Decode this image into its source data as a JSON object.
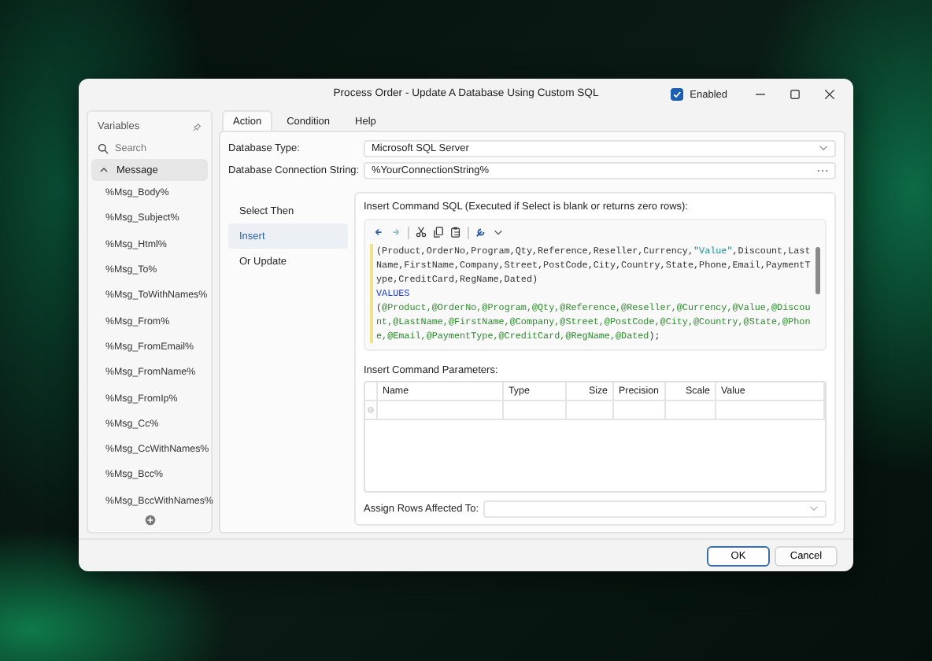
{
  "window": {
    "title": "Process Order - Update A Database Using Custom SQL",
    "enabled": {
      "label": "Enabled",
      "checked": true
    }
  },
  "sidebar": {
    "title": "Variables",
    "search": {
      "placeholder": "Search"
    },
    "group": {
      "label": "Message",
      "expanded": true,
      "selected": true
    },
    "items": [
      "%Msg_Body%",
      "%Msg_Subject%",
      "%Msg_Html%",
      "%Msg_To%",
      "%Msg_ToWithNames%",
      "%Msg_From%",
      "%Msg_FromEmail%",
      "%Msg_FromName%",
      "%Msg_FromIp%",
      "%Msg_Cc%",
      "%Msg_CcWithNames%",
      "%Msg_Bcc%",
      "%Msg_BccWithNames%"
    ]
  },
  "tabs": [
    {
      "label": "Action",
      "selected": true
    },
    {
      "label": "Condition",
      "selected": false
    },
    {
      "label": "Help",
      "selected": false
    }
  ],
  "fields": [
    {
      "label": "Database Type:",
      "value": "Microsoft SQL Server",
      "kind": "dropdown"
    },
    {
      "label": "Database Connection String:",
      "value": "%YourConnectionString%",
      "kind": "browse"
    }
  ],
  "modes": [
    {
      "label": "Select Then",
      "selected": false
    },
    {
      "label": "Insert",
      "selected": true
    },
    {
      "label": "Or Update",
      "selected": false
    }
  ],
  "sql": {
    "label": "Insert Command SQL (Executed if Select is blank or returns zero rows):",
    "lines": [
      [
        {
          "text": "(Product,OrderNo,Program,Qty,Reference,Reseller,Currency,",
          "kind": "plain"
        },
        {
          "text": "\"Value\"",
          "kind": "string"
        },
        {
          "text": ",Discount,Last",
          "kind": "plain"
        }
      ],
      [
        {
          "text": "Name,FirstName,Company,Street,PostCode,City,Country,State,Phone,Email,PaymentT",
          "kind": "plain"
        }
      ],
      [
        {
          "text": "ype,CreditCard,RegName,Dated)",
          "kind": "plain"
        }
      ],
      [
        {
          "text": "VALUES",
          "kind": "keyword"
        }
      ],
      [
        {
          "text": "(",
          "kind": "plain"
        },
        {
          "text": "@Product,@OrderNo,@Program,@Qty,@Reference,@Reseller,@Currency,@Value,@Discou",
          "kind": "param"
        }
      ],
      [
        {
          "text": "nt,@LastName,@FirstName,@Company,@Street,@PostCode,@City,@Country,@State,@Phon",
          "kind": "param"
        }
      ],
      [
        {
          "text": "e,@Email,@PaymentType,@CreditCard,@RegName,@Dated",
          "kind": "param"
        },
        {
          "text": ");",
          "kind": "plain"
        }
      ]
    ]
  },
  "parameters": {
    "label": "Insert Command Parameters:",
    "columns": [
      "Name",
      "Type",
      "Size",
      "Precision",
      "Scale",
      "Value"
    ]
  },
  "assign": {
    "label": "Assign Rows Affected To:"
  },
  "buttons": [
    {
      "label": "OK",
      "kind": "primary"
    },
    {
      "label": "Cancel",
      "kind": "secondary"
    }
  ]
}
